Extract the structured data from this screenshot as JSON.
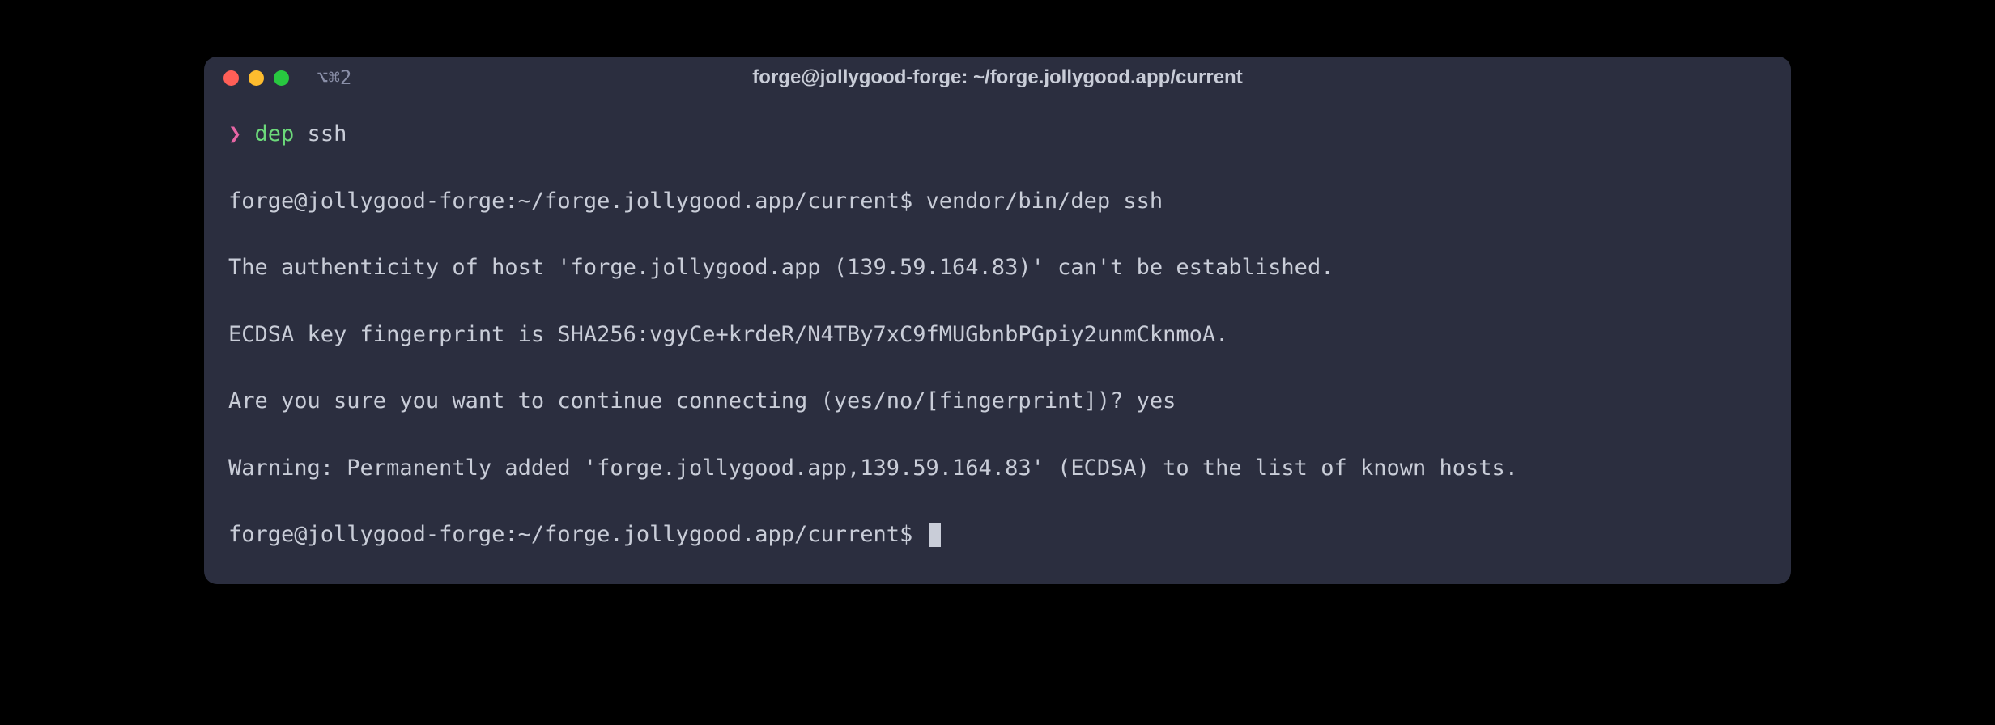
{
  "window": {
    "title": "forge@jollygood-forge: ~/forge.jollygood.app/current",
    "tab_label": "⌥⌘2"
  },
  "prompt": {
    "arrow": "❯",
    "command": "dep",
    "arg": "ssh"
  },
  "lines": {
    "line1": "forge@jollygood-forge:~/forge.jollygood.app/current$ vendor/bin/dep ssh",
    "line2": "The authenticity of host 'forge.jollygood.app (139.59.164.83)' can't be established.",
    "line3": "ECDSA key fingerprint is SHA256:vgyCe+krdeR/N4TBy7xC9fMUGbnbPGpiy2unmCknmoA.",
    "line4": "Are you sure you want to continue connecting (yes/no/[fingerprint])? yes",
    "line5": "Warning: Permanently added 'forge.jollygood.app,139.59.164.83' (ECDSA) to the list of known hosts.",
    "line6": "forge@jollygood-forge:~/forge.jollygood.app/current$ "
  }
}
